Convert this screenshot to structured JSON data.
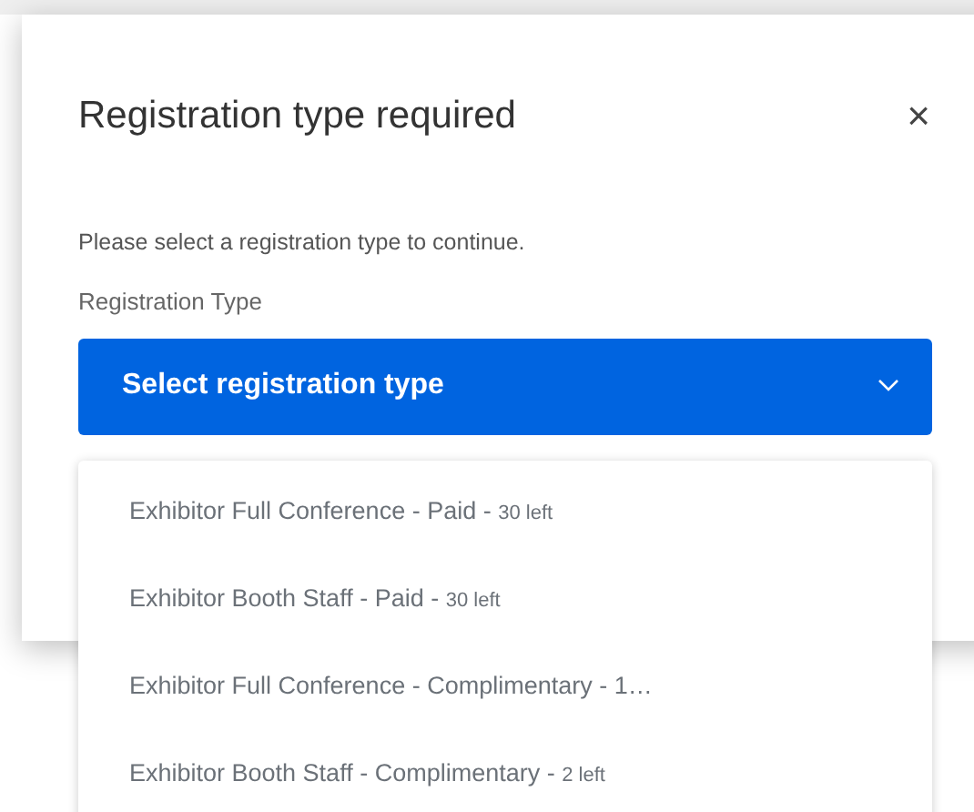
{
  "dialog": {
    "title": "Registration type required",
    "close": "×",
    "message": "Please select a registration type to continue.",
    "field_label": "Registration Type",
    "select": {
      "value": "Select registration type",
      "expanded": true
    },
    "options": [
      {
        "label": "Exhibitor Full Conference - Paid - ",
        "count": "30 left"
      },
      {
        "label": "Exhibitor Booth Staff - Paid - ",
        "count": "30 left"
      },
      {
        "label": "Exhibitor Full Conference - Complimentary - 1…"
      },
      {
        "label": "Exhibitor Booth Staff - Complimentary - ",
        "count": "2 left"
      }
    ]
  }
}
